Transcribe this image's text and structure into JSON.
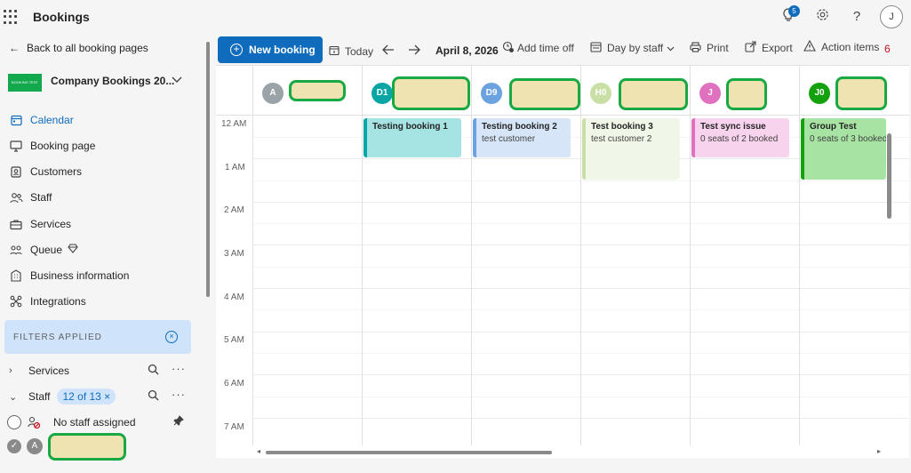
{
  "app": {
    "title": "Bookings",
    "notification_count": "5",
    "user_initial": "J"
  },
  "sidebar": {
    "back_label": "Back to all booking pages",
    "company": {
      "logo_text": "BOOKING TEST",
      "name": "Company Bookings 20..."
    },
    "nav": [
      {
        "label": "Calendar",
        "icon": "calendar-icon"
      },
      {
        "label": "Booking page",
        "icon": "monitor-icon"
      },
      {
        "label": "Customers",
        "icon": "contact-card-icon"
      },
      {
        "label": "Staff",
        "icon": "people-icon"
      },
      {
        "label": "Services",
        "icon": "briefcase-icon"
      },
      {
        "label": "Queue",
        "icon": "queue-icon"
      },
      {
        "label": "Business information",
        "icon": "building-icon"
      },
      {
        "label": "Integrations",
        "icon": "integrations-icon"
      }
    ],
    "filters": {
      "applied_label": "FILTERS APPLIED",
      "services_label": "Services",
      "staff_label": "Staff",
      "staff_chip": "12 of 13 ×",
      "no_staff_label": "No staff assigned",
      "staff_first_initial": "A"
    }
  },
  "toolbar": {
    "new_booking": "New booking",
    "today": "Today",
    "date": "April 8, 2026",
    "add_time_off": "Add time off",
    "view": "Day by staff",
    "print": "Print",
    "export": "Export",
    "action_items": "Action items",
    "action_count": "6"
  },
  "calendar": {
    "staff": [
      {
        "initials": "A",
        "color": "#9aa3a8"
      },
      {
        "initials": "D1",
        "color": "#0aa5a5"
      },
      {
        "initials": "D9",
        "color": "#6aa3e0"
      },
      {
        "initials": "H0",
        "color": "#c9dfa6"
      },
      {
        "initials": "J",
        "color": "#e070c0"
      },
      {
        "initials": "J0",
        "color": "#13a10e"
      }
    ],
    "time_labels": [
      "12 AM",
      "1 AM",
      "2 AM",
      "3 AM",
      "4 AM",
      "5 AM",
      "6 AM",
      "7 AM"
    ],
    "events": [
      {
        "title": "Testing booking 1",
        "subtitle": "",
        "bg": "#a6e3e3",
        "border": "#0aa5a5"
      },
      {
        "title": "Testing booking 2",
        "subtitle": "test customer",
        "bg": "#d6e6f8",
        "border": "#6aa3e0"
      },
      {
        "title": "Test booking 3",
        "subtitle": "test customer 2",
        "bg": "#f1f7e8",
        "border": "#c9dfa6"
      },
      {
        "title": "Test sync issue",
        "subtitle": "0 seats of 2 booked",
        "bg": "#f8d3ee",
        "border": "#e070c0"
      },
      {
        "title": "Group Test",
        "subtitle": "0 seats of 3 booked",
        "bg": "#a7e3a3",
        "border": "#13a10e"
      }
    ]
  }
}
